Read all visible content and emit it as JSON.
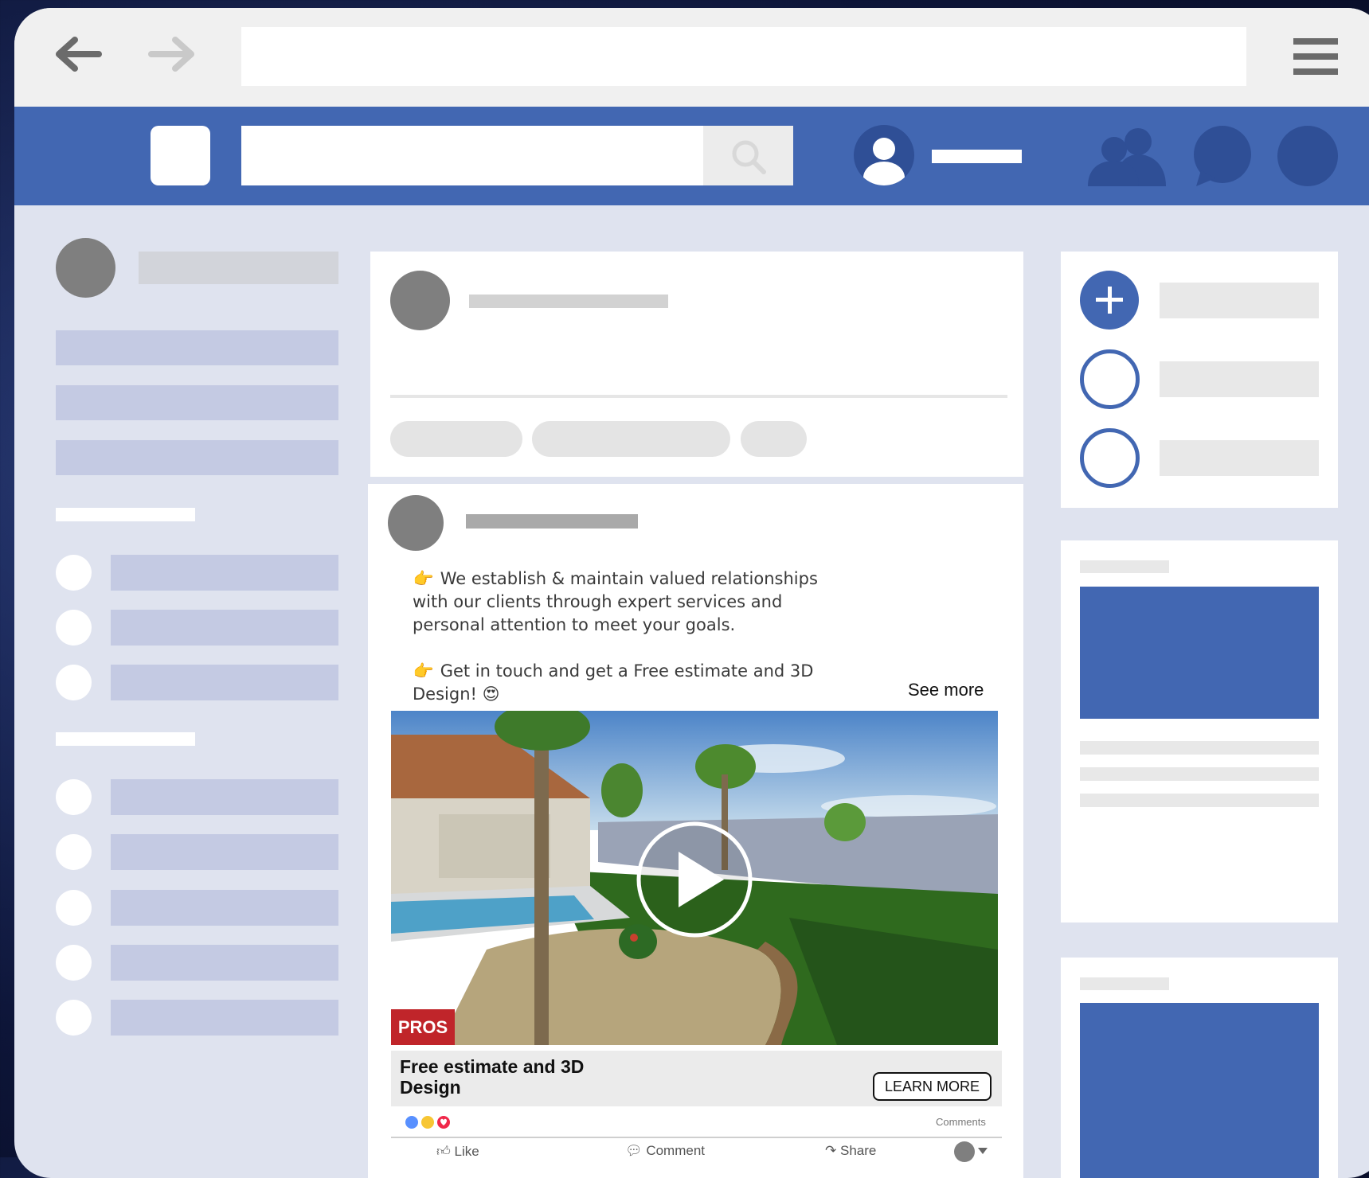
{
  "post": {
    "line1_prefix": "👉",
    "line1": "We establish & maintain valued relationships with our clients through expert services and personal attention to meet your goals.",
    "line2_prefix": "👉",
    "line2": "Get in touch and get a Free estimate and 3D Design!",
    "line2_emoji": "😍",
    "see_more": "See more",
    "ad_title": "Free estimate and 3D Design",
    "cta": "LEARN MORE",
    "comments_label": "Comments",
    "actions": {
      "like": "Like",
      "comment": "Comment",
      "share": "Share"
    },
    "video_watermark": "PROS"
  },
  "colors": {
    "facebook_blue": "#4267b2",
    "background": "#dfe3ef",
    "lavender": "#c4cae3"
  },
  "icons": [
    "back-arrow-icon",
    "forward-arrow-icon",
    "hamburger-menu-icon",
    "search-icon",
    "user-avatar-icon",
    "friends-icon",
    "messenger-icon",
    "notifications-icon",
    "plus-icon",
    "play-icon",
    "like-icon",
    "comment-icon",
    "share-icon"
  ]
}
